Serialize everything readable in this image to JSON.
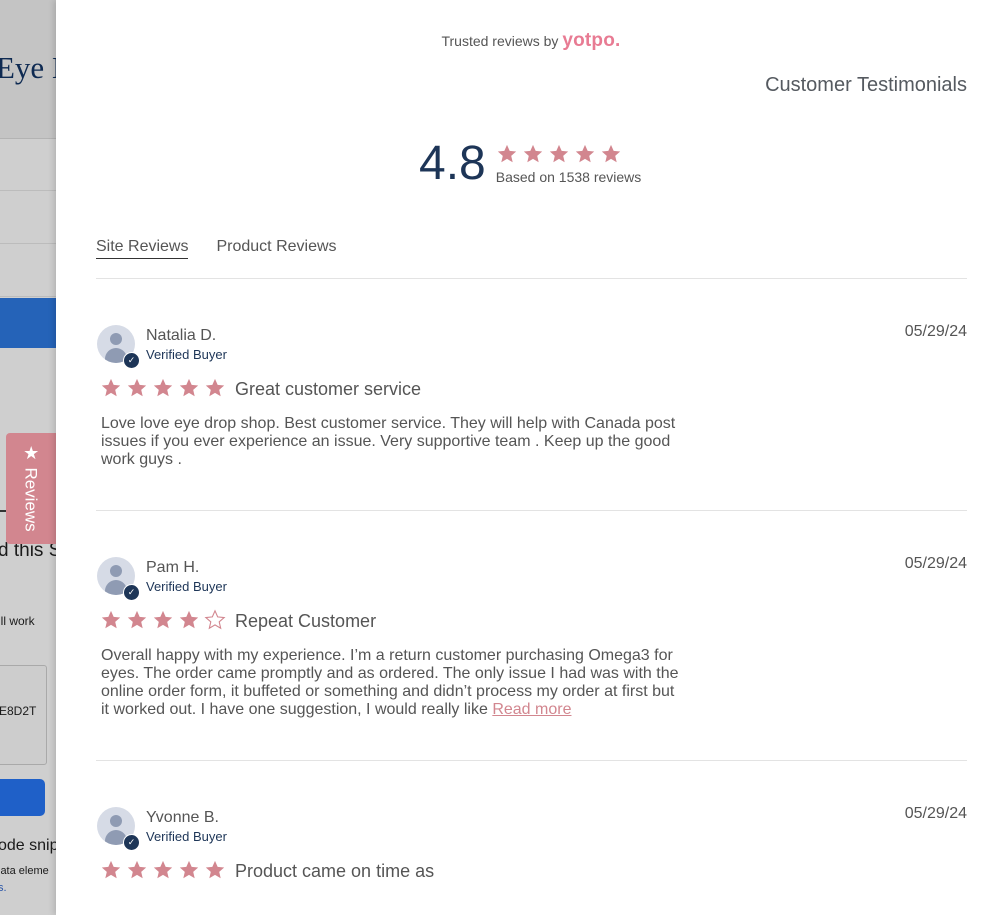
{
  "background": {
    "title_fragment": "Eye D",
    "text_1": "d this S",
    "text_2": "ill work",
    "text_3": "E8D2T",
    "text_4": "ode snipp",
    "text_5": "lata eleme",
    "text_6": "s."
  },
  "reviews_tab": {
    "label": "Reviews",
    "icon": "star-icon"
  },
  "modal": {
    "trusted_prefix": "Trusted reviews by",
    "brand": "yotpo.",
    "section_title": "Customer Testimonials",
    "average": "4.8",
    "average_stars": 5,
    "based_on": "Based on 1538 reviews",
    "tabs": [
      {
        "label": "Site Reviews",
        "active": true
      },
      {
        "label": "Product Reviews",
        "active": false
      }
    ]
  },
  "reviews": [
    {
      "name": "Natalia D.",
      "verified": "Verified Buyer",
      "date": "05/29/24",
      "rating": 5,
      "title": "Great customer service",
      "body": "Love love eye drop shop. Best customer service. They will help with Canada post issues if you ever experience an issue. Very supportive team . Keep up the good work guys .",
      "read_more": ""
    },
    {
      "name": "Pam H.",
      "verified": "Verified Buyer",
      "date": "05/29/24",
      "rating": 4,
      "title": "Repeat Customer",
      "body": "Overall happy with my experience. I’m a return customer purchasing Omega3 for eyes. The order came promptly and as ordered. The only issue I had was with the online order form, it buffeted or something and didn’t process my order at first but it worked out. I have one suggestion, I would really like ",
      "read_more": "Read more"
    },
    {
      "name": "Yvonne B.",
      "verified": "Verified Buyer",
      "date": "05/29/24",
      "rating": 5,
      "title": "Product came on time as",
      "body": "",
      "read_more": ""
    }
  ],
  "colors": {
    "star": "#d2868f",
    "brand": "#e87b93",
    "navy": "#1d3557",
    "tab_bg": "#d2868f"
  }
}
